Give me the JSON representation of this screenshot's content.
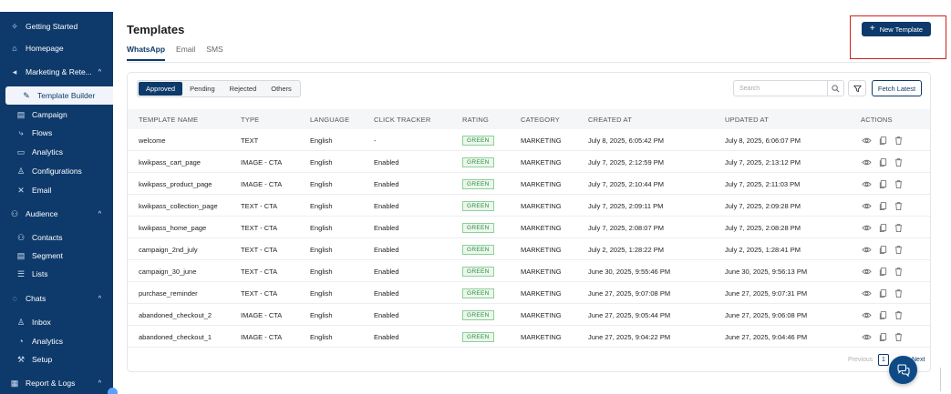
{
  "colors": {
    "brand": "#0e3a6b",
    "highlight": "#d0201b",
    "badge_green": "#2e8b3e"
  },
  "sidebar": {
    "items": [
      {
        "label": "Getting Started",
        "icon": "sparkle-icon"
      },
      {
        "label": "Homepage",
        "icon": "home-icon"
      },
      {
        "label": "Marketing & Rete...",
        "icon": "megaphone-icon",
        "chevron": "^"
      },
      {
        "label": "Template Builder",
        "icon": "brush-icon",
        "active": true
      },
      {
        "label": "Campaign",
        "icon": "document-icon"
      },
      {
        "label": "Flows",
        "icon": "flow-icon"
      },
      {
        "label": "Analytics",
        "icon": "chart-icon"
      },
      {
        "label": "Configurations",
        "icon": "settings-icon"
      },
      {
        "label": "Email",
        "icon": "email-icon"
      },
      {
        "label": "Audience",
        "icon": "audience-icon",
        "chevron": "^"
      },
      {
        "label": "Contacts",
        "icon": "contacts-icon"
      },
      {
        "label": "Segment",
        "icon": "segment-icon"
      },
      {
        "label": "Lists",
        "icon": "list-icon"
      },
      {
        "label": "Chats",
        "icon": "chat-icon",
        "chevron": "^"
      },
      {
        "label": "Inbox",
        "icon": "person-icon"
      },
      {
        "label": "Analytics",
        "icon": "analytics-icon"
      },
      {
        "label": "Setup",
        "icon": "wrench-icon"
      },
      {
        "label": "Report & Logs",
        "icon": "report-icon",
        "chevron": "^"
      }
    ]
  },
  "header": {
    "title": "Templates",
    "new_button_label": "New Template",
    "tabs": [
      {
        "label": "WhatsApp",
        "active": true
      },
      {
        "label": "Email"
      },
      {
        "label": "SMS"
      }
    ]
  },
  "filters": {
    "segments": [
      {
        "label": "Approved",
        "active": true
      },
      {
        "label": "Pending"
      },
      {
        "label": "Rejected"
      },
      {
        "label": "Others"
      }
    ],
    "search_placeholder": "Search",
    "fetch_label": "Fetch Latest"
  },
  "table": {
    "columns": [
      "TEMPLATE NAME",
      "TYPE",
      "LANGUAGE",
      "CLICK TRACKER",
      "RATING",
      "CATEGORY",
      "CREATED AT",
      "UPDATED AT",
      "ACTIONS"
    ],
    "rows": [
      {
        "name": "welcome",
        "type": "TEXT",
        "language": "English",
        "tracker": "-",
        "rating": "GREEN",
        "category": "MARKETING",
        "created": "July 8, 2025, 6:05:42 PM",
        "updated": "July 8, 2025, 6:06:07 PM"
      },
      {
        "name": "kwikpass_cart_page",
        "type": "IMAGE - CTA",
        "language": "English",
        "tracker": "Enabled",
        "rating": "GREEN",
        "category": "MARKETING",
        "created": "July 7, 2025, 2:12:59 PM",
        "updated": "July 7, 2025, 2:13:12 PM"
      },
      {
        "name": "kwikpass_product_page",
        "type": "IMAGE - CTA",
        "language": "English",
        "tracker": "Enabled",
        "rating": "GREEN",
        "category": "MARKETING",
        "created": "July 7, 2025, 2:10:44 PM",
        "updated": "July 7, 2025, 2:11:03 PM"
      },
      {
        "name": "kwikpass_collection_page",
        "type": "TEXT - CTA",
        "language": "English",
        "tracker": "Enabled",
        "rating": "GREEN",
        "category": "MARKETING",
        "created": "July 7, 2025, 2:09:11 PM",
        "updated": "July 7, 2025, 2:09:28 PM"
      },
      {
        "name": "kwikpass_home_page",
        "type": "TEXT - CTA",
        "language": "English",
        "tracker": "Enabled",
        "rating": "GREEN",
        "category": "MARKETING",
        "created": "July 7, 2025, 2:08:07 PM",
        "updated": "July 7, 2025, 2:08:28 PM"
      },
      {
        "name": "campaign_2nd_july",
        "type": "TEXT - CTA",
        "language": "English",
        "tracker": "Enabled",
        "rating": "GREEN",
        "category": "MARKETING",
        "created": "July 2, 2025, 1:28:22 PM",
        "updated": "July 2, 2025, 1:28:41 PM"
      },
      {
        "name": "campaign_30_june",
        "type": "TEXT - CTA",
        "language": "English",
        "tracker": "Enabled",
        "rating": "GREEN",
        "category": "MARKETING",
        "created": "June 30, 2025, 9:55:46 PM",
        "updated": "June 30, 2025, 9:56:13 PM"
      },
      {
        "name": "purchase_reminder",
        "type": "TEXT - CTA",
        "language": "English",
        "tracker": "Enabled",
        "rating": "GREEN",
        "category": "MARKETING",
        "created": "June 27, 2025, 9:07:08 PM",
        "updated": "June 27, 2025, 9:07:31 PM"
      },
      {
        "name": "abandoned_checkout_2",
        "type": "IMAGE - CTA",
        "language": "English",
        "tracker": "Enabled",
        "rating": "GREEN",
        "category": "MARKETING",
        "created": "June 27, 2025, 9:05:44 PM",
        "updated": "June 27, 2025, 9:06:08 PM"
      },
      {
        "name": "abandoned_checkout_1",
        "type": "IMAGE - CTA",
        "language": "English",
        "tracker": "Enabled",
        "rating": "GREEN",
        "category": "MARKETING",
        "created": "June 27, 2025, 9:04:22 PM",
        "updated": "June 27, 2025, 9:04:46 PM"
      }
    ]
  },
  "pagination": {
    "prev_label": "Previous",
    "current_page": "1",
    "next_label": "Next"
  }
}
